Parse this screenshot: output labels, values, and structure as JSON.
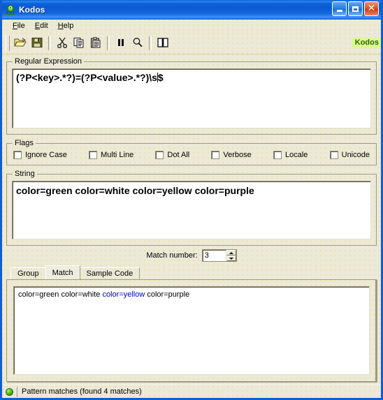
{
  "window": {
    "title": "Kodos",
    "app_icon": "kodos-alien-icon",
    "buttons": {
      "minimize": "minimize-icon",
      "maximize": "maximize-icon",
      "close": "close-icon"
    }
  },
  "menubar": {
    "items": [
      {
        "label": "File",
        "mnemonic": "F"
      },
      {
        "label": "Edit",
        "mnemonic": "E"
      },
      {
        "label": "Help",
        "mnemonic": "H"
      }
    ]
  },
  "toolbar": {
    "buttons": [
      {
        "name": "open-icon",
        "title": "Open"
      },
      {
        "name": "save-icon",
        "title": "Save"
      },
      {
        "name": "cut-icon",
        "title": "Cut"
      },
      {
        "name": "copy-icon",
        "title": "Copy"
      },
      {
        "name": "paste-icon",
        "title": "Paste"
      },
      {
        "name": "pause-icon",
        "title": "Pause"
      },
      {
        "name": "search-icon",
        "title": "Search"
      },
      {
        "name": "reference-icon",
        "title": "Reference"
      }
    ],
    "badge": "Kodos",
    "badge_bg": "#ddfa8c",
    "badge_fg": "#2f5f10"
  },
  "regex_group": {
    "legend": "Regular Expression",
    "value_before_caret": "(?P<key>.*?)=(?P<value>.*?)\\s",
    "value_after_caret": "$",
    "full_value": "(?P<key>.*?)=(?P<value>.*?)\\s$"
  },
  "flags_group": {
    "legend": "Flags",
    "items": [
      {
        "label": "Ignore Case",
        "checked": false
      },
      {
        "label": "Multi Line",
        "checked": false
      },
      {
        "label": "Dot All",
        "checked": false
      },
      {
        "label": "Verbose",
        "checked": false
      },
      {
        "label": "Locale",
        "checked": false
      },
      {
        "label": "Unicode",
        "checked": false
      }
    ]
  },
  "string_group": {
    "legend": "String",
    "value": "color=green color=white color=yellow color=purple"
  },
  "match_number": {
    "label": "Match number:",
    "value": "3"
  },
  "tabs": {
    "items": [
      {
        "label": "Group",
        "active": false
      },
      {
        "label": "Match",
        "active": true
      },
      {
        "label": "Sample Code",
        "active": false
      }
    ],
    "match_panel": {
      "prefix": "color=green color=white ",
      "highlight": "color=yellow",
      "suffix": " color=purple",
      "highlight_color": "#0000cd"
    }
  },
  "statusbar": {
    "led": "green-status-icon",
    "text": "Pattern matches (found 4 matches)"
  }
}
